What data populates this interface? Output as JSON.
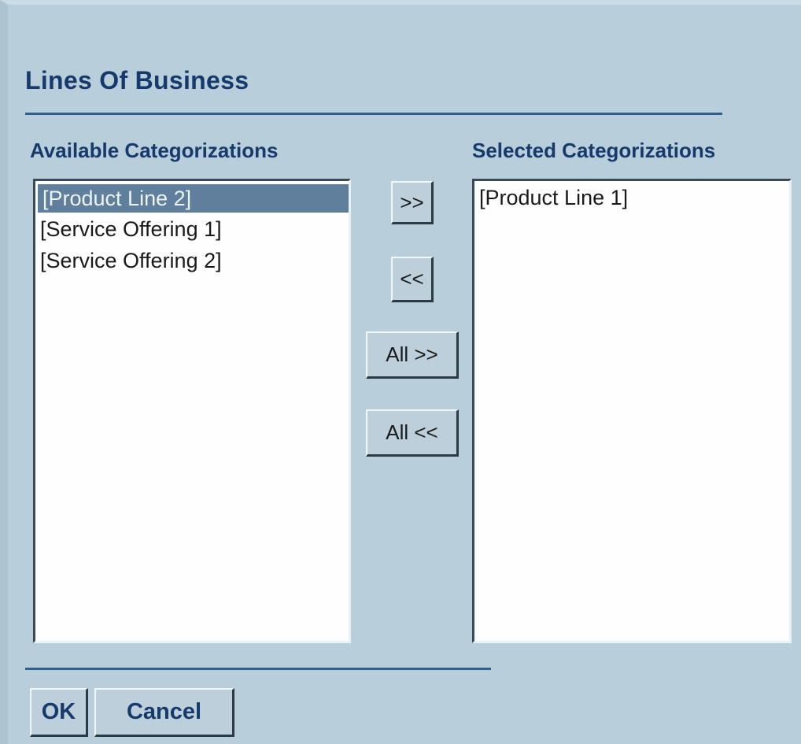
{
  "dialog": {
    "title": "Lines Of Business"
  },
  "available": {
    "label": "Available Categorizations",
    "items": [
      {
        "label": "[Product Line 2]",
        "selected": true
      },
      {
        "label": "[Service Offering 1]",
        "selected": false
      },
      {
        "label": "[Service Offering 2]",
        "selected": false
      }
    ]
  },
  "selected": {
    "label": "Selected Categorizations",
    "items": [
      {
        "label": "[Product Line 1]",
        "selected": false
      }
    ]
  },
  "transfer_buttons": {
    "add": ">>",
    "remove": "<<",
    "add_all": "All >>",
    "remove_all": "All <<"
  },
  "footer": {
    "ok": "OK",
    "cancel": "Cancel"
  },
  "colors": {
    "background": "#b9cedb",
    "heading": "#163a6b",
    "selection": "#5f7f9c"
  }
}
